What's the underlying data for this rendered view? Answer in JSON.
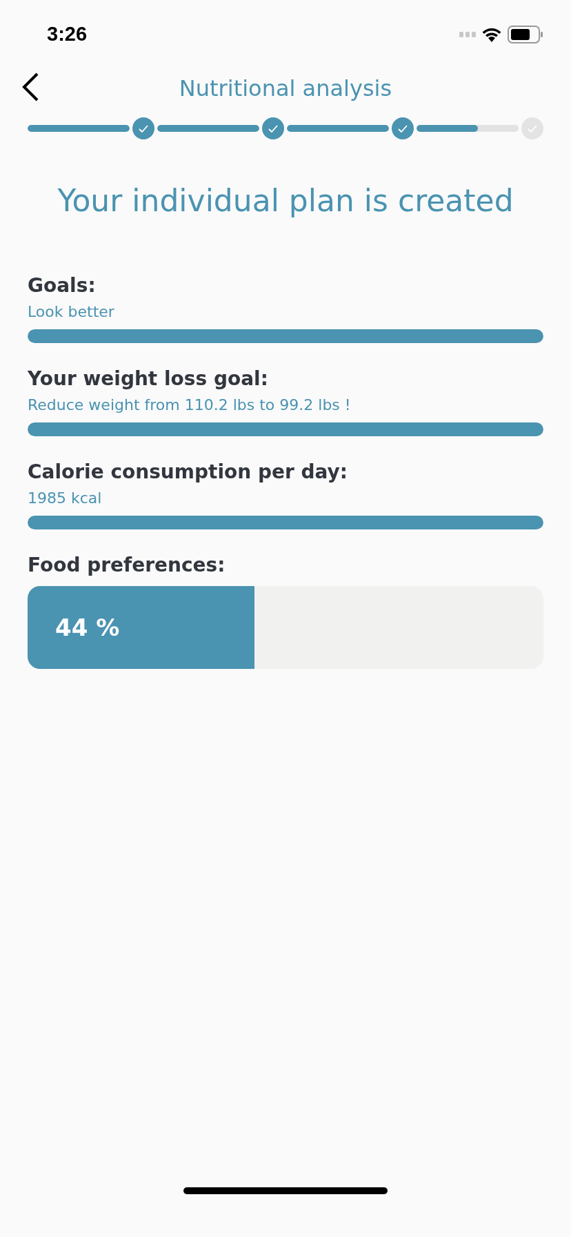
{
  "status_bar": {
    "time": "3:26"
  },
  "header": {
    "title": "Nutritional analysis"
  },
  "stepper": {
    "segments": [
      {
        "level": 1
      },
      {
        "level": 1
      },
      {
        "level": 1
      },
      {
        "level": 0.6
      }
    ],
    "steps": [
      {
        "done": true
      },
      {
        "done": true
      },
      {
        "done": true
      },
      {
        "done": false
      }
    ]
  },
  "heading": "Your individual plan is created",
  "sections": [
    {
      "kind": "thin",
      "label": "Goals:",
      "value": "Look better",
      "level": 1
    },
    {
      "kind": "thin",
      "label": "Your weight loss goal:",
      "value": "Reduce weight from 110.2 lbs to 99.2 lbs !",
      "level": 1
    },
    {
      "kind": "thin",
      "label": "Calorie consumption per day:",
      "value": "1985 kcal",
      "level": 1
    },
    {
      "kind": "large",
      "label": "Food preferences:",
      "reading": "44 %",
      "level": 0.44
    }
  ]
}
